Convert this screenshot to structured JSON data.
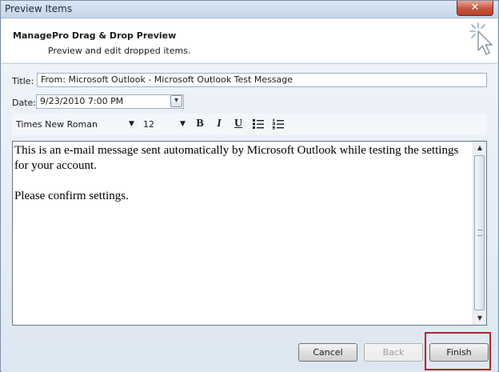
{
  "window": {
    "title": "Preview Items",
    "close_glyph": "✕"
  },
  "header": {
    "title": "ManagePro Drag & Drop Preview",
    "subtitle": "Preview and edit dropped items.",
    "icon": "wizard-cursor-icon"
  },
  "form": {
    "title_label": "Title:",
    "title_value": "From: Microsoft Outlook - Microsoft Outlook Test Message",
    "date_label": "Date:",
    "date_value": "9/23/2010 7:00 PM",
    "date_dropdown_glyph": "▾"
  },
  "toolbar": {
    "font_name": "Times New Roman",
    "font_size": "12",
    "caret": "▼",
    "bold_label": "B",
    "italic_label": "I",
    "underline_label": "U"
  },
  "editor": {
    "paragraph_1": "This is an e-mail message sent automatically by Microsoft Outlook while testing the settings for your account.",
    "paragraph_2": "Please confirm settings.",
    "scroll_up": "▲",
    "scroll_down": "▼"
  },
  "buttons": {
    "cancel": "Cancel",
    "back": "Back",
    "finish": "Finish"
  },
  "colors": {
    "highlight": "#b3262a",
    "close_button": "#c8533d"
  }
}
